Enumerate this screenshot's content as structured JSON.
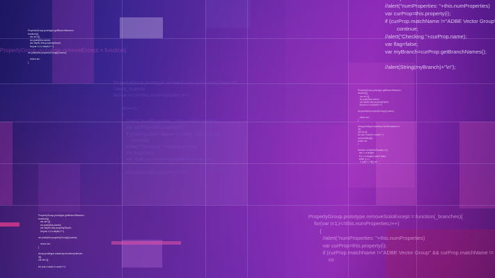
{
  "code_blocks": {
    "top_right": "          }\n//alert(\"numProperties: \"+this.numProperties)\nvar curProp=this.property(i);\nif (curProp.matchName !=\"ADBE Vector Group\")\n        continue;\n//alert(\"Checking \"+curProp.name);\nvar flag=false;\nvar myBranch=curProp.getBranchNames();\n\n//alert(String(myBranch)+\"\\n\");",
    "bottom_right": "PropertyGroup.prototype.removeSoloExcept = function(_branches){\n    for(var i=1;i<=this.numProperties;i++)\n        {\n          //alert(\"numProperties: \"+this.numProperties)\n          var curProp=this.property(i);\n          if (curProp.matchName !=\"ADBE Vector Group\" && curProp.matchName !=\n              co",
    "center": "PropertyGroup.prototype.removeExcept = function(_branch){\n//alert(_branch)\nfor(var i=1;i<=this.numProperties;i++)\n\n       if(i==1)\n       {\n          //alert(\"numProperties: \"+this.numProperties)\n          var curProp=this.property(i);\n          if (curProp.matchName !=\"ADBE Vector Group\")\n              continue;\n          //alert(\"Checking \"+curProp.name);\n          var flag=false;\n          var myBranch=curProp.getBranchNames();\n\n          //alert(String(myBranch)+\"\\n\");",
    "top_left_faint": "PropertyGroup.prototype.removeExcept = function(",
    "top_left_tiny": "PropertyGroup.prototype.getBranchNames=\nfunction(){\n   var arr=[];\n   arr.push(this.name);\n   var depth=this.propertyDepth;\n   for(var i=1;i<depth;i++)\n\narr.push(this.propertyGroup(i).name);\n\n   return arr;\n}",
    "mid_right_tiny": "PropertyGroup.prototype.getBranchNames=\nfunction(){\n   var arr=[];\n   arr.push(this.name);\n   var depth=this.propertyDepth;\n   for(var i=1;i<depth;i++)\n\narr.push(this.propertyGroup(i).name);\n\n   return arr;\n}\n\nArray.prototype.subarray=function(start,en\nd){\nvar arr=[];\nfor (var i=start;i<=end;i++)\narr.push(this[i]);\nreturn arr;\n}\n\nfunction arraysAreEqual(a, b) {\n  var i = a.length;\n  if (i != b.length) return false;\n  while (i--) {\n    if (a[i] !== b[i]) ret",
    "bottom_left_tiny": "PropertyGroup.prototype.getBranchNames=\nfunction(){\n   var arr=[];\n   arr.push(this.name);\n   var depth=this.propertyDepth;\n   for(var i=1;i<depth;i++)\n\narr.push(this.propertyGroup(i).name);\n\n   return arr;\n}\n\nArray.prototype.subarray=function(start,en\nd){\nvar arr=[];\n\nfor (var i=start;i<=end;i++)"
  },
  "colors": {
    "accent_magenta": "#c03ccc",
    "deep_purple": "#3a1a78",
    "violet": "#6a2aa8"
  }
}
